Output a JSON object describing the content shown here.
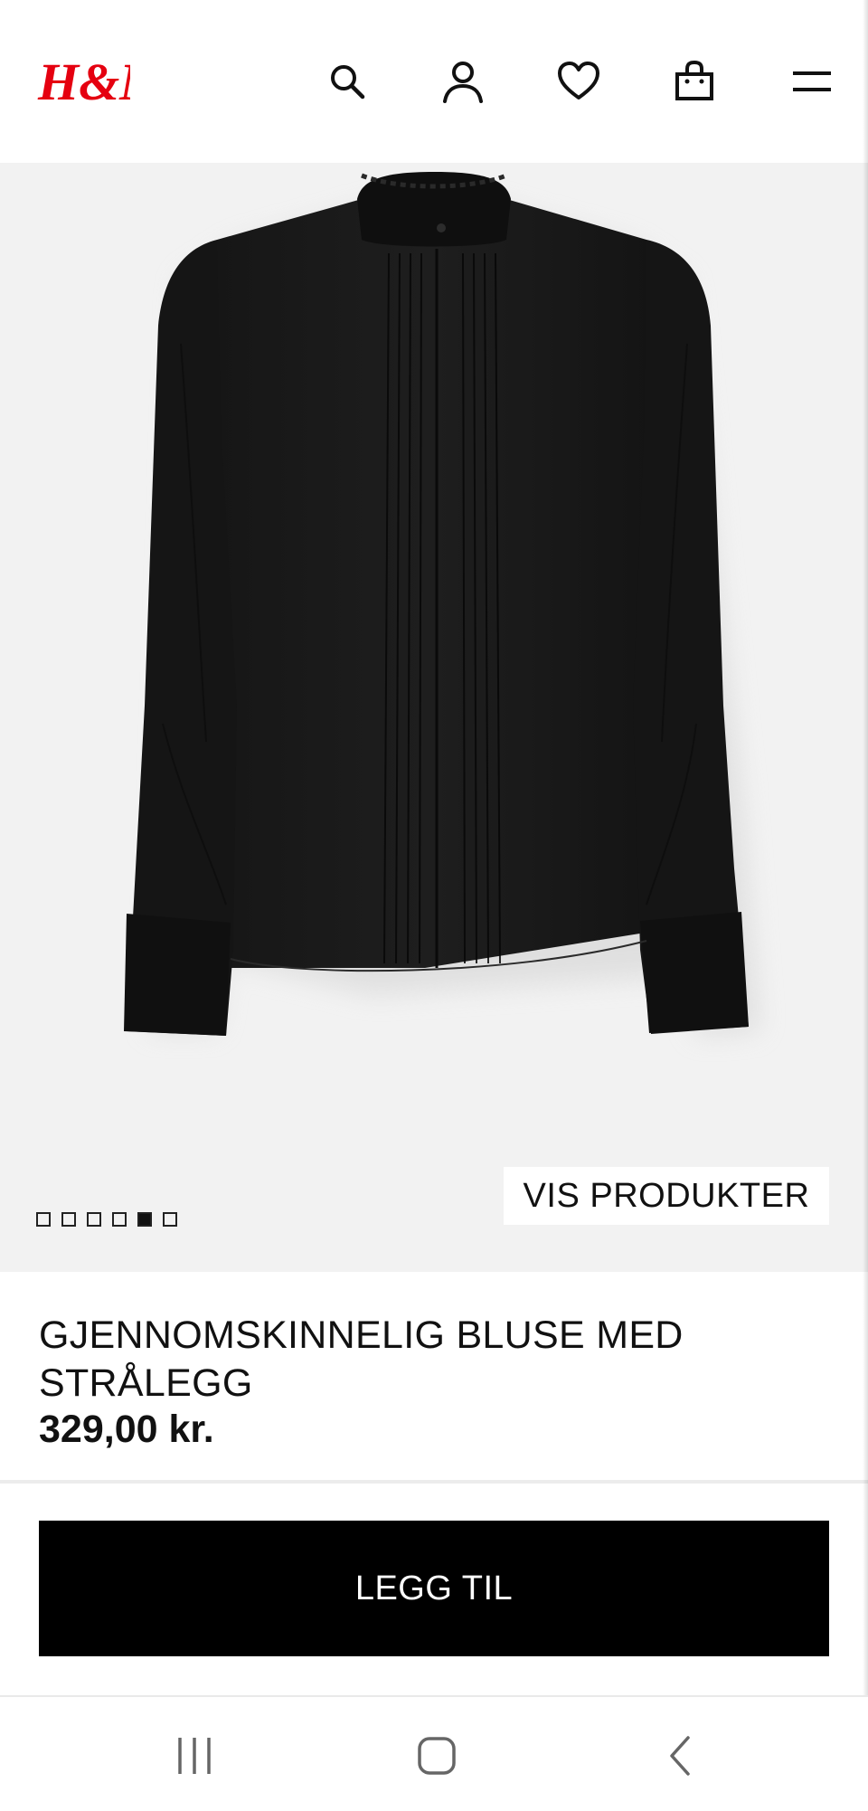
{
  "header": {
    "logo_text": "H&M",
    "brand_color": "#e50010",
    "icons": [
      "search-icon",
      "account-icon",
      "heart-icon",
      "bag-icon",
      "menu-icon"
    ]
  },
  "gallery": {
    "image_count": 6,
    "active_index": 4,
    "view_products_label": "VIS PRODUKTER"
  },
  "product": {
    "title": "GJENNOMSKINNELIG BLUSE MED STRÅLEGG",
    "price": "329,00 kr."
  },
  "actions": {
    "add_label": "LEGG TIL"
  },
  "system_nav": {
    "icons": [
      "recent-apps-icon",
      "home-icon",
      "back-icon"
    ]
  }
}
